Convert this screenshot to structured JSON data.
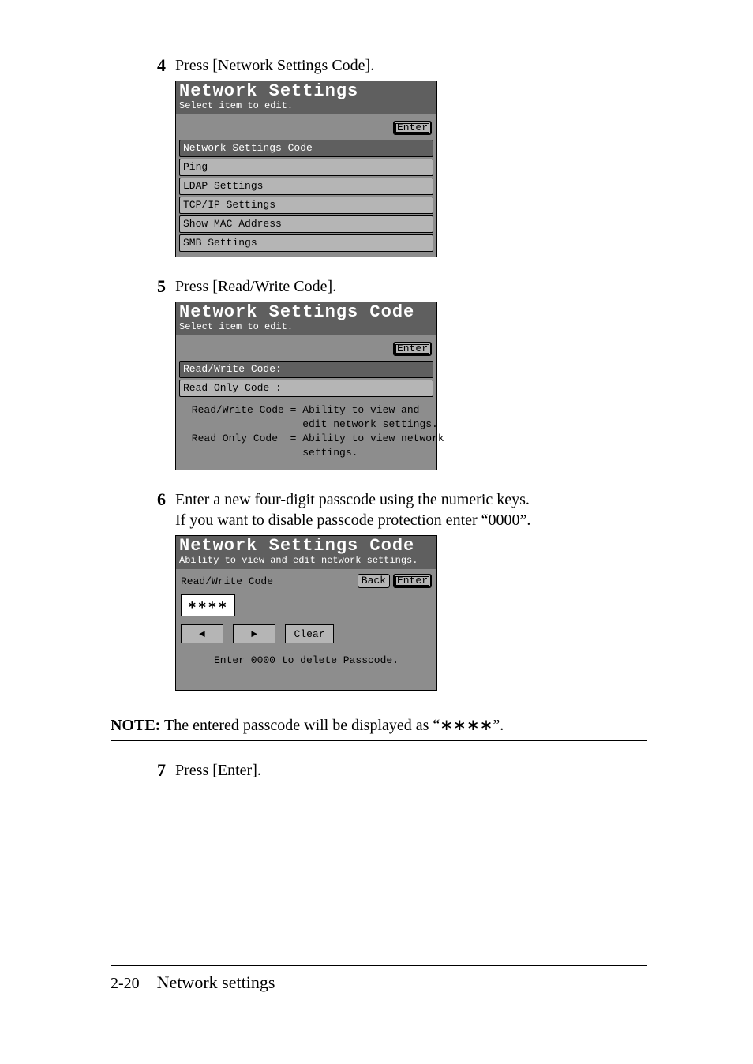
{
  "steps": {
    "s4": {
      "num": "4",
      "text": "Press [Network Settings Code]."
    },
    "s5": {
      "num": "5",
      "text": "Press [Read/Write Code]."
    },
    "s6": {
      "num": "6",
      "text_line1": "Enter a new four-digit passcode using the numeric keys.",
      "text_line2": "If you want to disable passcode protection enter “0000”."
    },
    "s7": {
      "num": "7",
      "text": "Press [Enter]."
    }
  },
  "lcd1": {
    "title": "Network Settings",
    "subtitle": "Select item to edit.",
    "enter": "Enter",
    "items": [
      "Network Settings Code",
      "Ping",
      "LDAP Settings",
      "TCP/IP Settings",
      "Show MAC Address",
      "SMB Settings"
    ]
  },
  "lcd2": {
    "title": "Network Settings Code",
    "subtitle": "Select item to edit.",
    "enter": "Enter",
    "items": [
      "Read/Write Code:",
      "Read Only Code :"
    ],
    "info": " Read/Write Code = Ability to view and\n                   edit network settings.\n Read Only Code  = Ability to view network\n                   settings."
  },
  "lcd3": {
    "title": "Network Settings Code",
    "subtitle": "Ability to view and edit network settings.",
    "label": "Read/Write Code",
    "back": "Back",
    "enter": "Enter",
    "code": "∗∗∗∗",
    "left": "◄",
    "right": "►",
    "clear": "Clear",
    "hint": "Enter 0000 to delete Passcode."
  },
  "note": {
    "label": "NOTE:",
    "text": " The entered passcode will be displayed as “∗∗∗∗”."
  },
  "footer": {
    "page": "2-20",
    "section": "Network settings"
  }
}
